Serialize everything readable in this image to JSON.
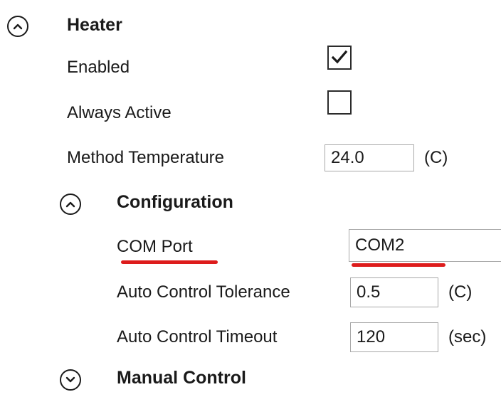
{
  "heater": {
    "title": "Heater",
    "expand_icon": "chevron-up-icon",
    "enabled": {
      "label": "Enabled",
      "checked": true
    },
    "always_active": {
      "label": "Always Active",
      "checked": false
    },
    "method_temperature": {
      "label": "Method Temperature",
      "value": "24.0",
      "unit": "(C)"
    }
  },
  "configuration": {
    "title": "Configuration",
    "expand_icon": "chevron-up-icon",
    "com_port": {
      "label": "COM Port",
      "value": "COM2"
    },
    "auto_control_tolerance": {
      "label": "Auto Control Tolerance",
      "value": "0.5",
      "unit": "(C)"
    },
    "auto_control_timeout": {
      "label": "Auto Control Timeout",
      "value": "120",
      "unit": "(sec)"
    }
  },
  "manual_control": {
    "title": "Manual Control",
    "expand_icon": "chevron-down-icon"
  },
  "annotation_color": "#dd1c1c"
}
